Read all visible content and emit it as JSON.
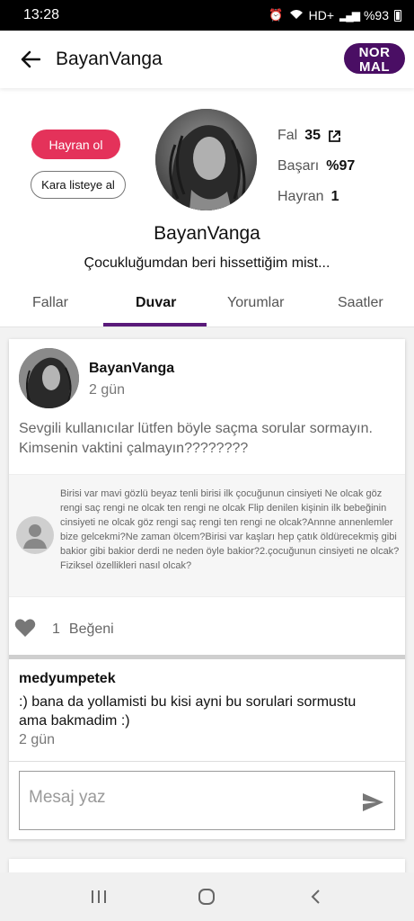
{
  "status": {
    "time": "13:28",
    "network": "HD+",
    "battery": "%93"
  },
  "app_bar": {
    "title": "BayanVanga",
    "badge_line1": "NOR",
    "badge_line2": "MAL"
  },
  "profile": {
    "follow_button": "Hayran ol",
    "blacklist_button": "Kara listeye al",
    "name": "BayanVanga",
    "bio": "Çocukluğumdan beri hissettiğim mist...",
    "stats": {
      "fal_label": "Fal",
      "fal_value": "35",
      "basari_label": "Başarı",
      "basari_value": "%97",
      "hayran_label": "Hayran",
      "hayran_value": "1"
    }
  },
  "tabs": [
    {
      "label": "Fallar"
    },
    {
      "label": "Duvar"
    },
    {
      "label": "Yorumlar"
    },
    {
      "label": "Saatler"
    }
  ],
  "post": {
    "author": "BayanVanga",
    "time": "2 gün",
    "text": "Sevgili kullanıcılar lütfen böyle saçma sorular sormayın. Kimsenin vaktini çalmayın????????",
    "question": "Birisi  var mavi gözlü beyaz tenli birisi ilk çocuğunun cinsiyeti Ne olcak göz rengi saç rengi ne olcak ten rengi ne olcak Flip denilen kişinin ilk bebeğinin cinsiyeti ne olcak göz rengi saç rengi ten rengi ne olcak?Annne annenlemler bize gelcekmi?Ne zaman ölcem?Birisi var kaşları hep çatık öldürecekmiş gibi bakior gibi bakior derdi ne neden öyle bakior?2.çocuğunun cinsiyeti ne olcak?Fiziksel özellikleri nasıl olcak?",
    "like_count": "1",
    "like_label": "Beğeni"
  },
  "comment": {
    "author": "medyumpetek",
    "text": ":) bana da yollamisti bu kisi ayni bu sorulari sormustu ama bakmadim :)",
    "time": "2 gün"
  },
  "message": {
    "placeholder": "Mesaj yaz"
  },
  "colors": {
    "accent_purple": "#5a1a7a",
    "badge_purple": "#4a0e64",
    "follow_red": "#e4325a"
  }
}
